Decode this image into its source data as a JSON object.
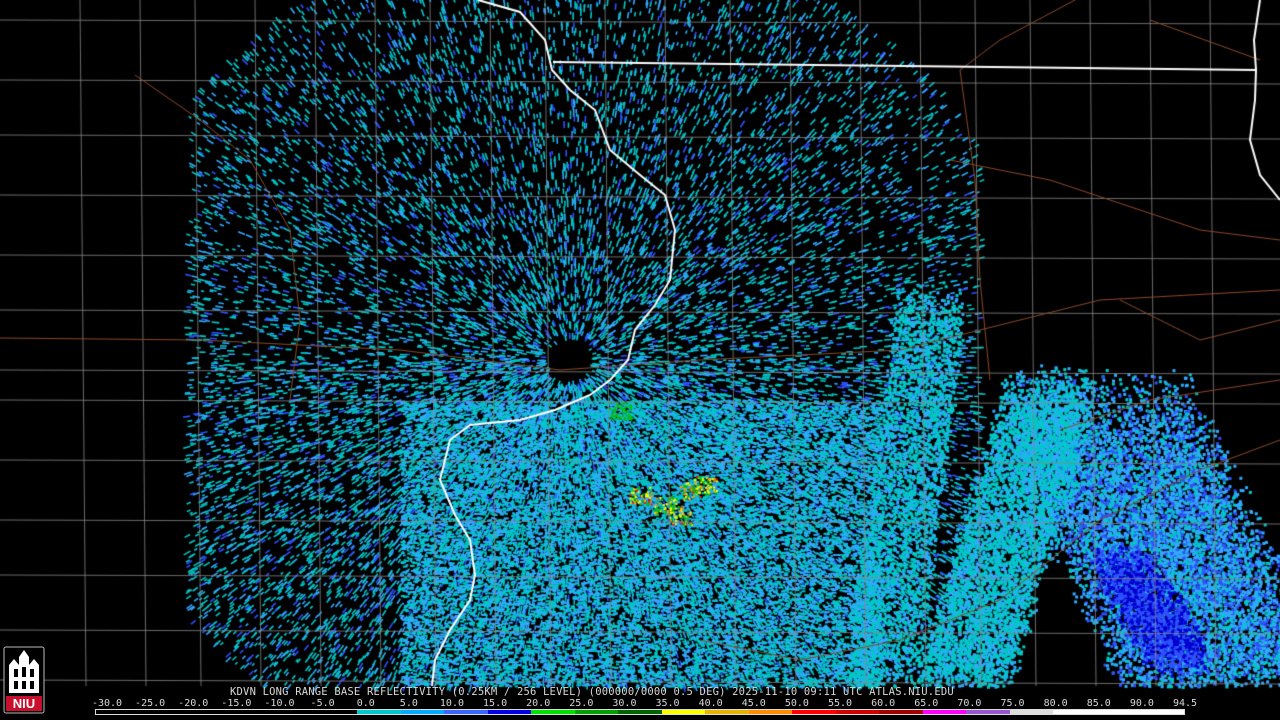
{
  "caption": "KDVN LONG RANGE BASE REFLECTIVITY (0.25KM / 256 LEVEL) (000000/0000 0.5 DEG) 2025-11-10 09:11 UTC  ATLAS.NIU.EDU",
  "scale": {
    "labels": [
      "-30.0",
      "-25.0",
      "-20.0",
      "-15.0",
      "-10.0",
      "-5.0",
      "0.0",
      "5.0",
      "10.0",
      "15.0",
      "20.0",
      "25.0",
      "30.0",
      "35.0",
      "40.0",
      "45.0",
      "50.0",
      "55.0",
      "60.0",
      "65.0",
      "70.0",
      "75.0",
      "80.0",
      "85.0",
      "90.0",
      "94.5"
    ],
    "colors": [
      "#000000",
      "#000000",
      "#000000",
      "#000000",
      "#000000",
      "#000000",
      "#00c8c8",
      "#00aaff",
      "#3c64ff",
      "#0000e0",
      "#00e000",
      "#00a000",
      "#006400",
      "#ffff00",
      "#e6b400",
      "#ff8c00",
      "#ff0000",
      "#d00000",
      "#a00000",
      "#ff00ff",
      "#9955cc",
      "#dddddd",
      "#ffffff",
      "#ffffff",
      "#ffffff"
    ]
  },
  "logo": {
    "text": "NIU",
    "color": "#c8102e"
  },
  "map": {
    "state_border_color": "#ffffff",
    "county_line_color": "#888888",
    "highway_color": "#8b4a2b",
    "echo_colors": [
      "#00c8c8",
      "#33aaff",
      "#3050ff",
      "#0000d0",
      "#00c000",
      "#ffff00",
      "#ff9900",
      "#ff0000"
    ]
  }
}
